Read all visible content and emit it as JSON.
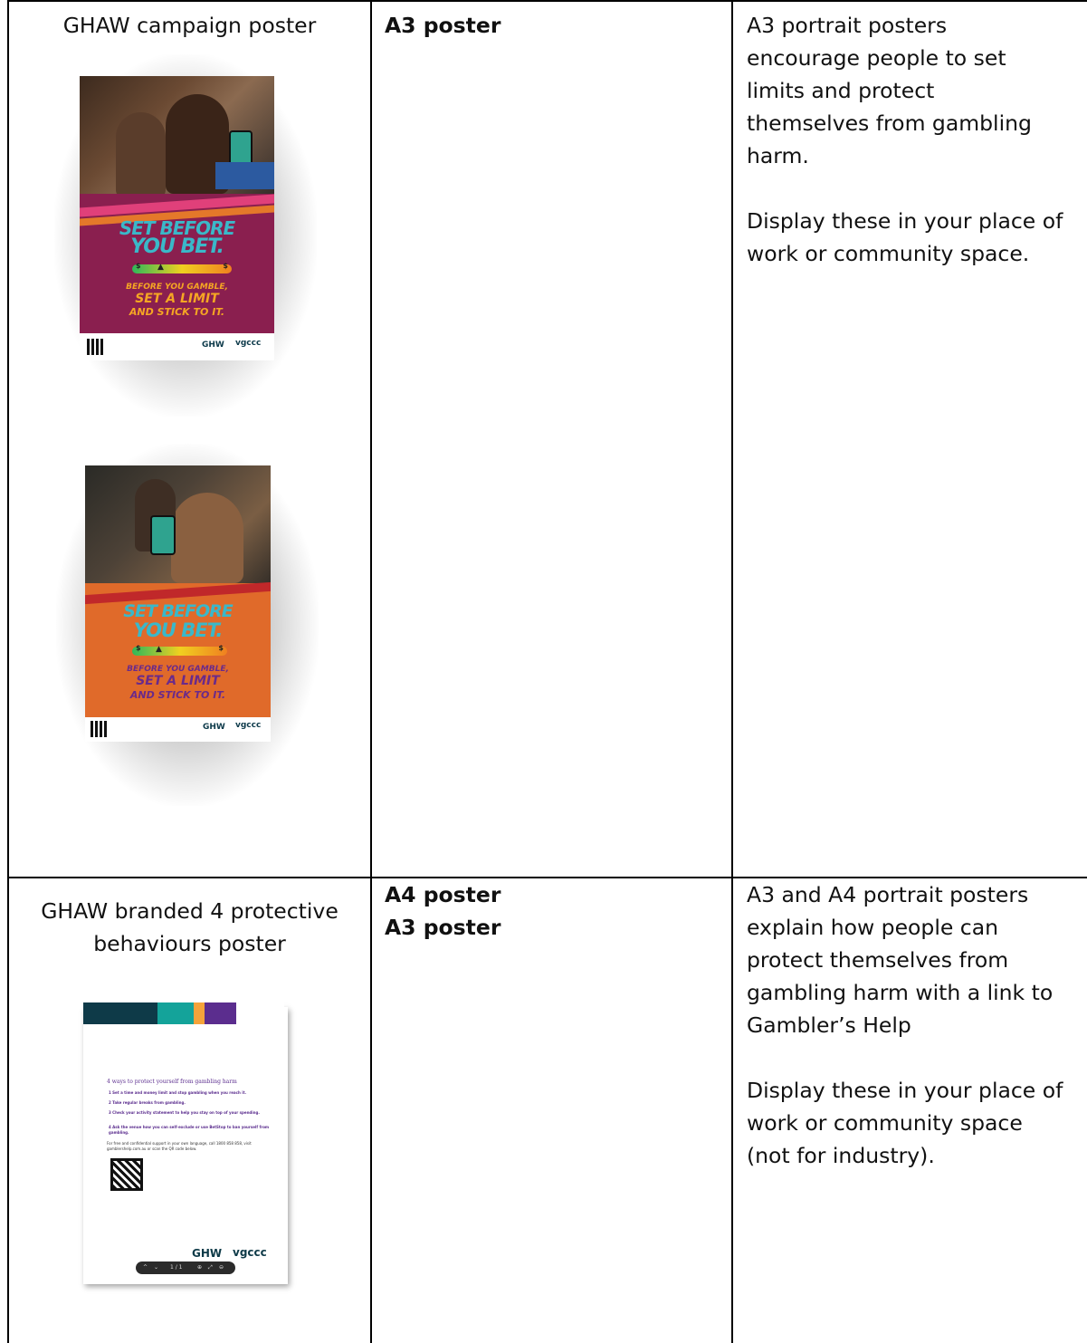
{
  "rows": [
    {
      "title": "GHAW campaign poster",
      "formats": [
        "A3 poster"
      ],
      "description": [
        "A3 portrait posters",
        "encourage people to set",
        "limits and protect",
        "themselves from gambling",
        "harm.",
        "",
        "Display these in your place of",
        "work or community space."
      ],
      "posters": [
        {
          "headline_1": "SET BEFORE",
          "headline_2": "YOU BET.",
          "meter_left": "$",
          "meter_right": "$",
          "sub_1": "BEFORE YOU GAMBLE,",
          "sub_2": "SET A LIMIT",
          "sub_3": "AND STICK TO IT.",
          "logo_1": "GHW",
          "logo_2": "vgccc",
          "bg_color": "#8a1f4f"
        },
        {
          "headline_1": "SET BEFORE",
          "headline_2": "YOU BET.",
          "meter_left": "$",
          "meter_right": "$",
          "sub_1": "BEFORE YOU GAMBLE,",
          "sub_2": "SET A LIMIT",
          "sub_3": "AND STICK TO IT.",
          "logo_1": "GHW",
          "logo_2": "vgccc",
          "bg_color": "#e06a2a"
        }
      ]
    },
    {
      "title_lines": [
        "GHAW branded 4 protective",
        "behaviours poster"
      ],
      "formats": [
        "A4 poster",
        "A3 poster"
      ],
      "description": [
        "A3 and A4 portrait posters",
        "explain how people can",
        "protect themselves from",
        "gambling harm with a link to",
        "Gambler’s Help",
        "",
        "Display these in your place of",
        "work or community space",
        "(not for industry)."
      ],
      "doc_poster": {
        "heading": "4 ways to protect yourself from gambling harm",
        "items": [
          "1  Set a time and money limit and stop gambling when you reach it.",
          "2  Take regular breaks from gambling.",
          "3  Check your activity statement to help you stay on top of your spending.",
          "4  Ask the venue how you can self-exclude or use BetStop to ban yourself from gambling."
        ],
        "footer": "For free and confidential support in your own language, call 1800 858 858, visit gamblershelp.com.au or scan the QR code below.",
        "logo_1": "GHW",
        "logo_2": "vgccc",
        "toolbar": "1 / 1"
      }
    }
  ]
}
